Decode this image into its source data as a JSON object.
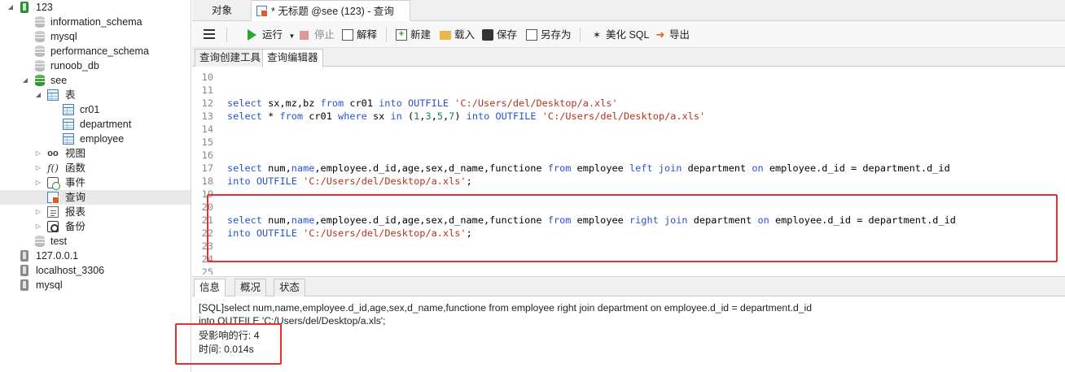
{
  "sidebar": {
    "connections": [
      {
        "label": "123"
      },
      {
        "label": "127.0.0.1"
      },
      {
        "label": "localhost_3306"
      },
      {
        "label": "mysql"
      }
    ],
    "databases": [
      {
        "label": "information_schema"
      },
      {
        "label": "mysql"
      },
      {
        "label": "performance_schema"
      },
      {
        "label": "runoob_db"
      },
      {
        "label": "see"
      },
      {
        "label": "test"
      }
    ],
    "see_children": {
      "tables_label": "表",
      "tables": [
        {
          "label": "cr01"
        },
        {
          "label": "department"
        },
        {
          "label": "employee"
        }
      ],
      "views_label": "视图",
      "functions_label": "函数",
      "events_label": "事件",
      "queries_label": "查询",
      "reports_label": "报表",
      "backups_label": "备份"
    }
  },
  "tabs": {
    "objects_label": "对象",
    "query_label": "* 无标题 @see (123) - 查询"
  },
  "toolbar": {
    "run_label": "运行",
    "stop_label": "停止",
    "explain_label": "解释",
    "new_label": "新建",
    "load_label": "载入",
    "save_label": "保存",
    "save_as_label": "另存为",
    "beautify_label": "美化 SQL",
    "export_label": "导出"
  },
  "sub_tabs": {
    "builder_label": "查询创建工具",
    "editor_label": "查询编辑器"
  },
  "editor": {
    "lines": [
      {
        "n": "10",
        "code": ""
      },
      {
        "n": "11",
        "code": ""
      },
      {
        "n": "12",
        "code": "select sx,mz,bz from cr01 into OUTFILE 'C:/Users/del/Desktop/a.xls'"
      },
      {
        "n": "13",
        "code": "select * from cr01 where sx in (1,3,5,7) into OUTFILE 'C:/Users/del/Desktop/a.xls'"
      },
      {
        "n": "14",
        "code": ""
      },
      {
        "n": "15",
        "code": ""
      },
      {
        "n": "16",
        "code": ""
      },
      {
        "n": "17",
        "code": "select num,name,employee.d_id,age,sex,d_name,functione from employee left join department on employee.d_id = department.d_id"
      },
      {
        "n": "18",
        "code": "into OUTFILE 'C:/Users/del/Desktop/a.xls';"
      },
      {
        "n": "19",
        "code": ""
      },
      {
        "n": "20",
        "code": ""
      },
      {
        "n": "21",
        "code": "select num,name,employee.d_id,age,sex,d_name,functione from employee right join department on employee.d_id = department.d_id"
      },
      {
        "n": "22",
        "code": "into OUTFILE 'C:/Users/del/Desktop/a.xls';"
      },
      {
        "n": "23",
        "code": ""
      },
      {
        "n": "24",
        "code": ""
      },
      {
        "n": "25",
        "code": ""
      }
    ]
  },
  "info_tabs": {
    "info_label": "信息",
    "overview_label": "概况",
    "status_label": "状态"
  },
  "info": {
    "sql_line1": "[SQL]select num,name,employee.d_id,age,sex,d_name,functione from employee right join department on employee.d_id = department.d_id",
    "sql_line2": "into OUTFILE 'C:/Users/del/Desktop/a.xls';",
    "affected_rows": "受影响的行: 4",
    "time": "时间: 0.014s"
  },
  "colors": {
    "keyword": "#2851d6",
    "string": "#b2321e",
    "number": "#098658",
    "annotation_box": "#e83030"
  }
}
